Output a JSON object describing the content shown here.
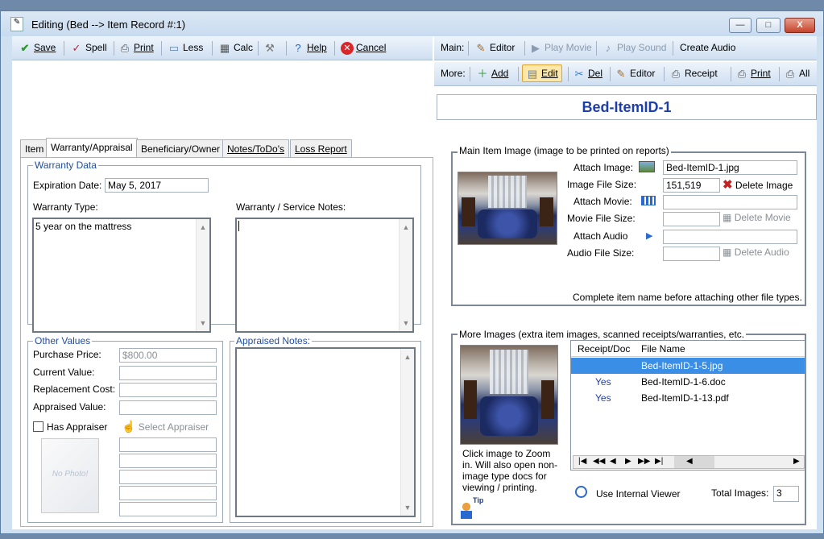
{
  "window": {
    "title": "Editing  (Bed --> Item Record #:1)",
    "min_label": "—",
    "max_label": "□",
    "close_label": "X"
  },
  "left_toolbar": {
    "save": "Save",
    "spell": "Spell",
    "print": "Print",
    "less": "Less",
    "calc": "Calc",
    "help": "Help",
    "cancel": "Cancel"
  },
  "main_toolbar": {
    "label": "Main:",
    "editor": "Editor",
    "play_movie": "Play Movie",
    "play_sound": "Play Sound",
    "create_audio": "Create Audio"
  },
  "more_toolbar": {
    "label": "More:",
    "add": "Add",
    "edit": "Edit",
    "del": "Del",
    "editor": "Editor",
    "receipt": "Receipt",
    "print": "Print",
    "all": "All"
  },
  "item_id": "Bed-ItemID-1",
  "tabs": [
    "Item",
    "Warranty/Appraisal",
    "Beneficiary/Owner",
    "Notes/ToDo's",
    "Loss Report"
  ],
  "warranty": {
    "group_label": "Warranty Data",
    "expiration_label": "Expiration Date:",
    "expiration_value": "May 5, 2017",
    "type_label": "Warranty Type:",
    "type_value": "5 year on the mattress",
    "notes_label": "Warranty / Service Notes:"
  },
  "other_values": {
    "group_label": "Other Values",
    "purchase_label": "Purchase Price:",
    "purchase_value": "$800.00",
    "current_label": "Current Value:",
    "replacement_label": "Replacement Cost:",
    "appraised_label": "Appraised Value:",
    "has_appraiser": "Has Appraiser",
    "select_appraiser": "Select Appraiser",
    "no_photo": "No Photo!"
  },
  "appraised_notes_label": "Appraised Notes:",
  "main_image": {
    "group_label": "Main Item Image (image to be printed on reports)",
    "attach_image_label": "Attach Image:",
    "attach_image_value": "Bed-ItemID-1.jpg",
    "image_size_label": "Image File Size:",
    "image_size_value": "151,519",
    "delete_image": "Delete Image",
    "attach_movie_label": "Attach Movie:",
    "movie_size_label": "Movie File Size:",
    "delete_movie": "Delete Movie",
    "attach_audio_label": "Attach Audio",
    "audio_size_label": "Audio File Size:",
    "delete_audio": "Delete Audio",
    "hint": "Complete item name before attaching other file types."
  },
  "more_images": {
    "group_label": "More Images (extra item images, scanned receipts/warranties, etc.",
    "col_receipt": "Receipt/Doc",
    "col_file": "File Name",
    "rows": [
      {
        "receipt": "",
        "file": "Bed-ItemID-1-5.jpg"
      },
      {
        "receipt": "Yes",
        "file": "Bed-ItemID-1-6.doc"
      },
      {
        "receipt": "Yes",
        "file": "Bed-ItemID-1-13.pdf"
      }
    ],
    "click_hint": "Click image to Zoom in. Will also open non-image type docs for viewing / printing.",
    "tip": "Tip",
    "use_viewer": "Use Internal Viewer",
    "total_label": "Total Images:",
    "total_value": "3"
  }
}
